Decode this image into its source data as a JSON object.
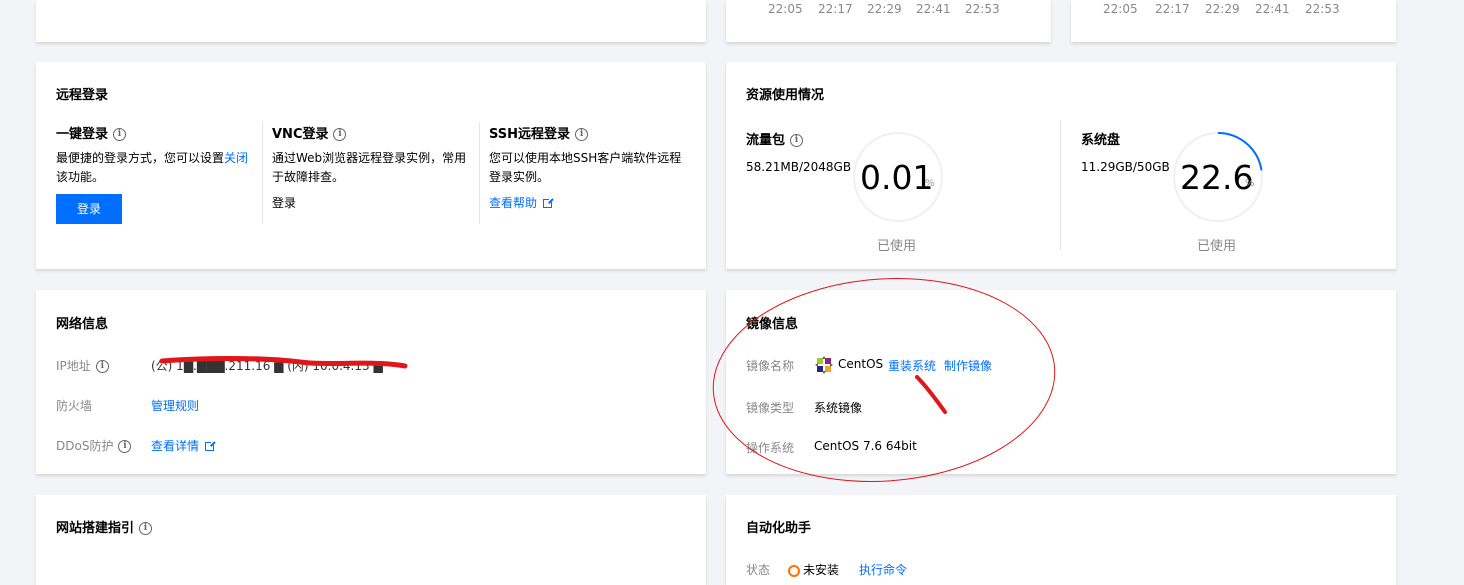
{
  "chart_top_left": {
    "ticks": [
      "22:05",
      "22:17",
      "22:29",
      "22:41",
      "22:53"
    ]
  },
  "chart_top_right": {
    "ticks": [
      "22:05",
      "22:17",
      "22:29",
      "22:41",
      "22:53"
    ]
  },
  "remote_login": {
    "title": "远程登录",
    "one_click": {
      "heading": "一键登录",
      "desc_prefix": "最便捷的登录方式，您可以设置",
      "desc_link": "关闭",
      "desc_suffix": "该功能。",
      "button": "登录"
    },
    "vnc": {
      "heading": "VNC登录",
      "desc": "通过Web浏览器远程登录实例，常用于故障排查。",
      "link": "登录"
    },
    "ssh": {
      "heading": "SSH远程登录",
      "desc": "您可以使用本地SSH客户端软件远程登录实例。",
      "link": "查看帮助"
    }
  },
  "resource_usage": {
    "title": "资源使用情况",
    "traffic": {
      "heading": "流量包",
      "amount": "58.21MB/2048GB",
      "value": "0.01",
      "unit": "%",
      "caption": "已使用",
      "percent": 0.01
    },
    "disk": {
      "heading": "系统盘",
      "amount": "11.29GB/50GB",
      "value": "22.6",
      "unit": "%",
      "caption": "已使用",
      "percent": 22.6
    }
  },
  "network": {
    "title": "网络信息",
    "ip_label": "IP地址",
    "ip_value": "(公) 1█.███.211.16 ▆   (内) 10.0.4.13 ▆",
    "firewall_label": "防火墙",
    "firewall_link": "管理规则",
    "ddos_label": "DDoS防护",
    "ddos_link": "查看详情"
  },
  "image": {
    "title": "镜像信息",
    "name_label": "镜像名称",
    "name_value": "CentOS",
    "reinstall_link": "重装系统",
    "make_image_link": "制作镜像",
    "type_label": "镜像类型",
    "type_value": "系统镜像",
    "os_label": "操作系统",
    "os_value": "CentOS 7.6 64bit"
  },
  "website_guide": {
    "title": "网站搭建指引"
  },
  "automation": {
    "title": "自动化助手",
    "status_label": "状态",
    "status_value": "未安装",
    "run_command_link": "执行命令"
  },
  "colors": {
    "accent": "#006eff",
    "annotation_red": "#e0161a",
    "gauge_track": "#eef0f3"
  }
}
